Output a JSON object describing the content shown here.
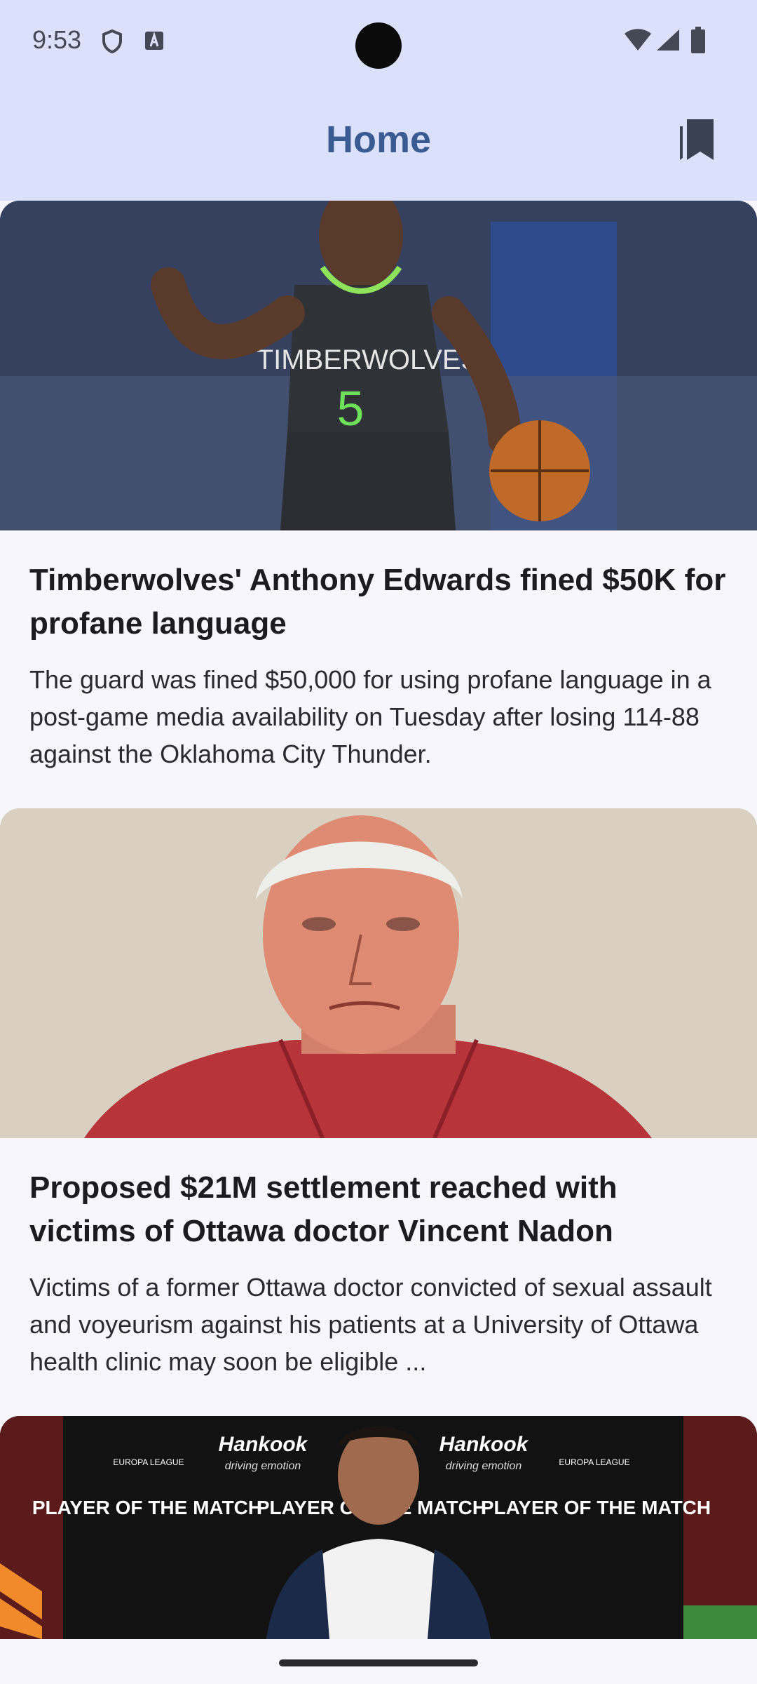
{
  "status_bar": {
    "time": "9:53"
  },
  "app_bar": {
    "title": "Home"
  },
  "articles": [
    {
      "headline": "Timberwolves' Anthony Edwards fined $50K for profane language",
      "summary": "The guard was fined $50,000 for using profane language in a post-game media availability on Tuesday after losing 114-88 against the Oklahoma City Thunder."
    },
    {
      "headline": "Proposed $21M settlement reached with victims of Ottawa doctor Vincent Nadon",
      "summary": "Victims of a former Ottawa doctor convicted of sexual assault and voyeurism against his patients at a University of Ottawa health clinic may soon be eligible ..."
    },
    {
      "headline": "",
      "summary": "",
      "image_text": {
        "sponsor": "Hankook",
        "tagline": "driving emotion",
        "board_text": "PLAYER OF THE MATCH",
        "league": "EUROPA LEAGUE"
      }
    }
  ]
}
